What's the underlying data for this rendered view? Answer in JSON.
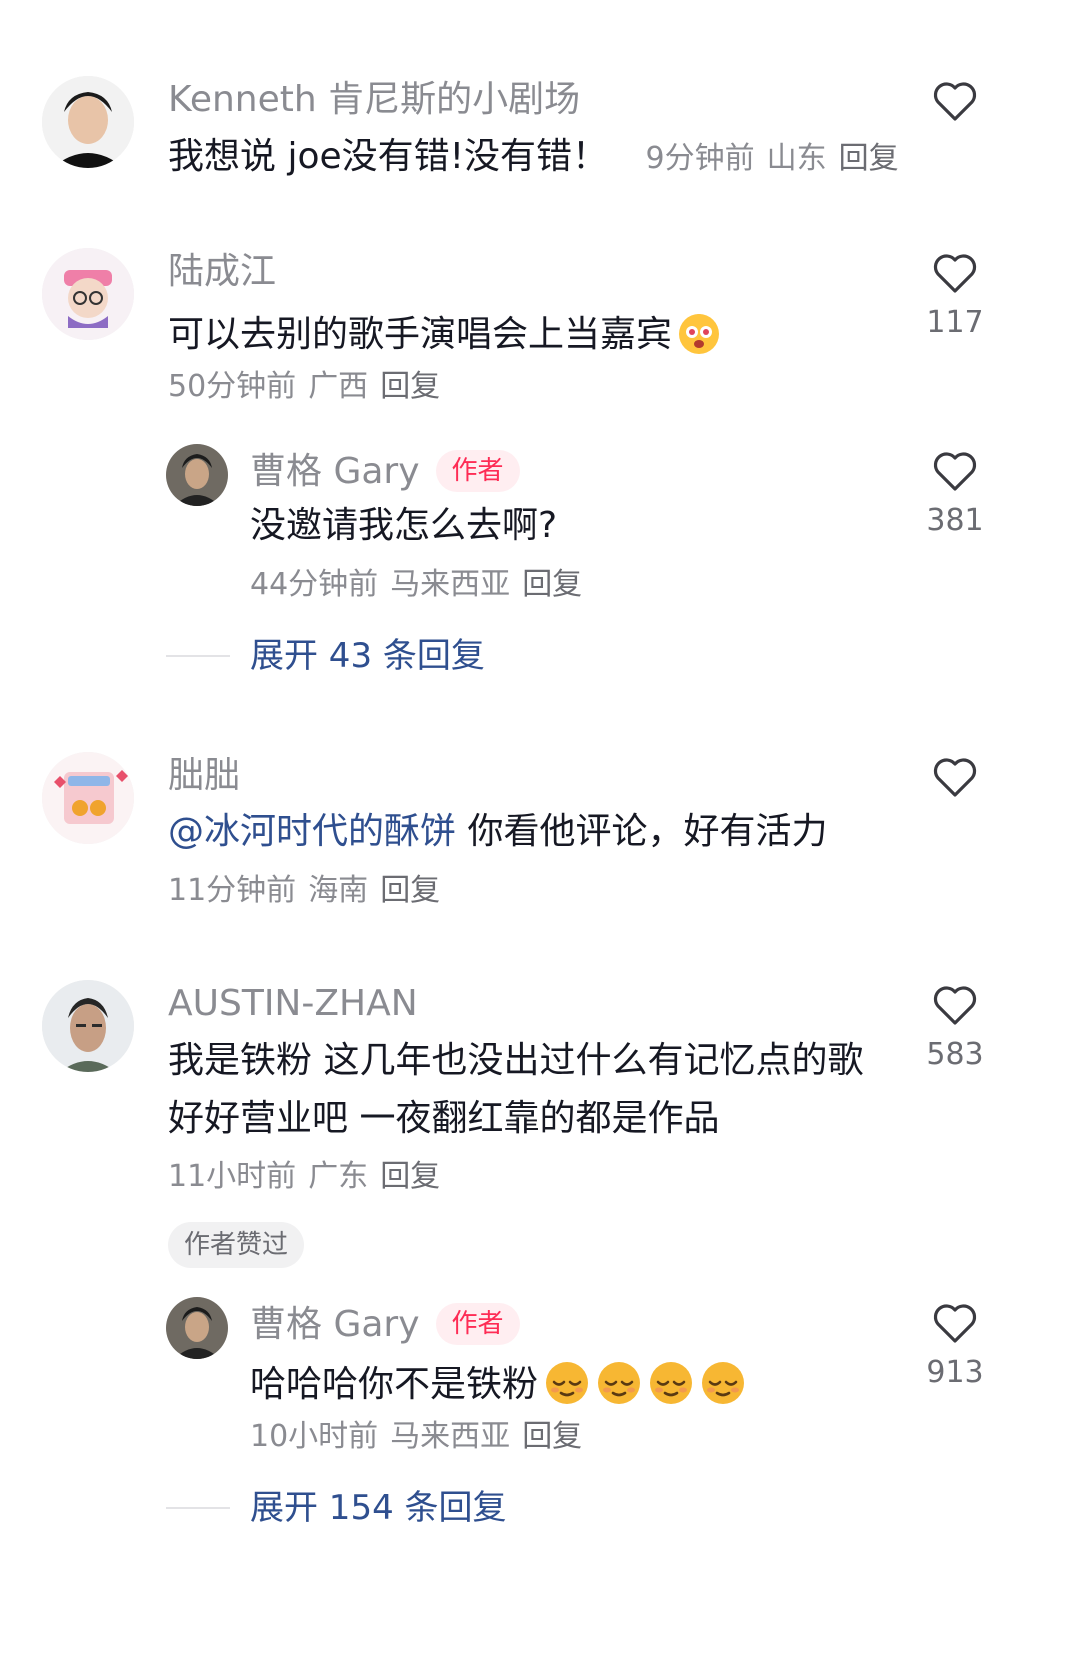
{
  "comments": [
    {
      "username": "Kenneth 肯尼斯的小剧场",
      "text": "我想说 joe没有错!没有错！",
      "time": "9分钟前",
      "location": "山东",
      "reply_label": "回复",
      "likes": ""
    },
    {
      "username": "陆成江",
      "text": "可以去别的歌手演唱会上当嘉宾",
      "emoji": "grinning-emoji",
      "time": "50分钟前",
      "location": "广西",
      "reply_label": "回复",
      "likes": "117",
      "reply": {
        "username": "曹格 Gary",
        "badge": "作者",
        "text": "没邀请我怎么去啊?",
        "time": "44分钟前",
        "location": "马来西亚",
        "reply_label": "回复",
        "likes": "381"
      },
      "expand_label": "展开 43 条回复"
    },
    {
      "username": "朏朏",
      "mention": "@冰河时代的酥饼",
      "text": " 你看他评论，好有活力",
      "time": "11分钟前",
      "location": "海南",
      "reply_label": "回复",
      "likes": ""
    },
    {
      "username": "AUSTIN-ZHAN",
      "text_line1": "我是铁粉 这几年也没出过什么有记忆点的歌",
      "text_line2": "好好营业吧 一夜翻红靠的都是作品",
      "time": "11小时前",
      "location": "广东",
      "reply_label": "回复",
      "likes": "583",
      "liked_by_author": "作者赞过",
      "reply": {
        "username": "曹格 Gary",
        "badge": "作者",
        "text": "哈哈哈你不是铁粉",
        "emoji": "relieved-emoji",
        "emoji_count": 4,
        "time": "10小时前",
        "location": "马来西亚",
        "reply_label": "回复",
        "likes": "913"
      },
      "expand_label": "展开 154 条回复"
    }
  ],
  "icons": {
    "like": "heart-outline-icon"
  },
  "colors": {
    "text": "#161823",
    "muted": "#8a8b91",
    "mention": "#2f4f8f",
    "author_badge": "#fe2c55"
  }
}
